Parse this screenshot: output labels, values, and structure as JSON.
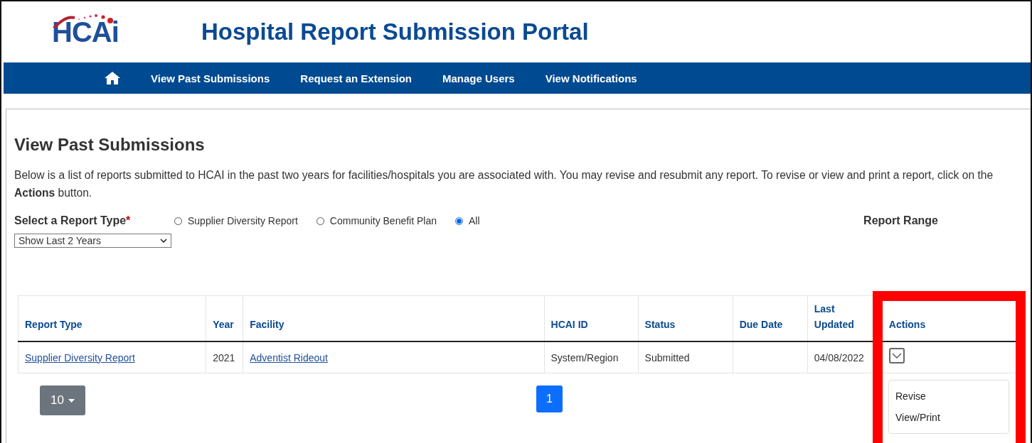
{
  "header": {
    "logo": "HCAi",
    "title": "Hospital Report Submission Portal"
  },
  "nav": {
    "items": [
      "View Past Submissions",
      "Request an Extension",
      "Manage Users",
      "View Notifications"
    ]
  },
  "page": {
    "heading": "View Past Submissions",
    "intro": "Below is a list of reports submitted to HCAI in the past two years for facilities/hospitals you are associated with. You may revise and resubmit any report. To revise or view and print a report, click on the **Actions** button."
  },
  "filter": {
    "label": "Select a Report Type",
    "required_mark": "*",
    "options": [
      {
        "label": "Supplier Diversity Report",
        "selected": false
      },
      {
        "label": "Community Benefit Plan",
        "selected": false
      },
      {
        "label": "All",
        "selected": true
      }
    ],
    "range_label": "Report Range",
    "range_value": "Show Last 2 Years"
  },
  "table": {
    "columns": [
      "Report Type",
      "Year",
      "Facility",
      "HCAI ID",
      "Status",
      "Due Date",
      "Last Updated",
      "Actions"
    ],
    "rows": [
      {
        "report_type": "Supplier Diversity Report",
        "year": "2021",
        "facility": "Adventist Rideout",
        "hcai_id": "System/Region",
        "status": "Submitted",
        "due_date": "",
        "last_updated": "04/08/2022",
        "actions_open": true
      }
    ]
  },
  "actions_menu": [
    "Revise",
    "View/Print"
  ],
  "pagination": {
    "page_size": "10",
    "pages": [
      {
        "label": "1",
        "selected": true
      }
    ]
  },
  "highlight": {
    "on": true
  }
}
